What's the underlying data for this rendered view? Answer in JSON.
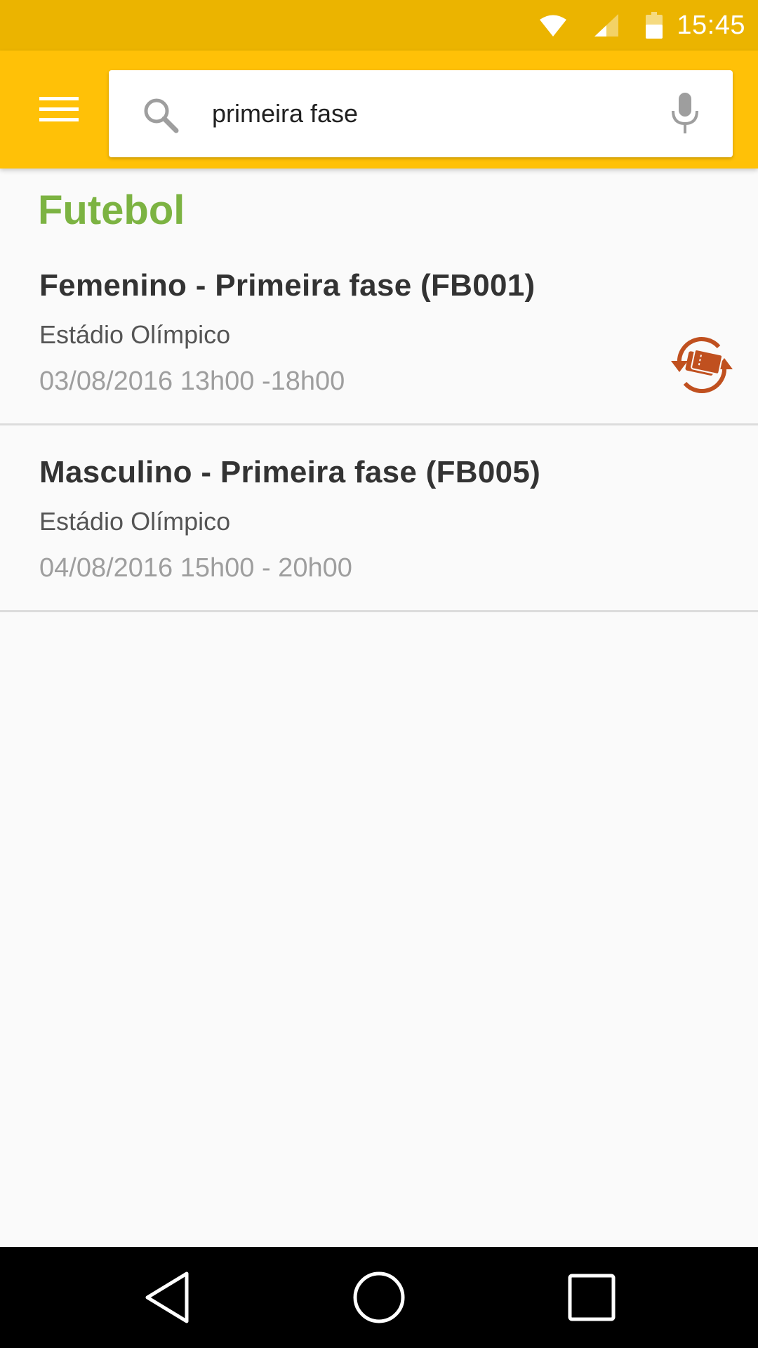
{
  "status_bar": {
    "time": "15:45",
    "icons": [
      "wifi-icon",
      "signal-icon",
      "battery-icon"
    ]
  },
  "toolbar": {
    "menu_icon": "hamburger-menu-icon",
    "search": {
      "value": "primeira fase",
      "search_icon": "search-icon",
      "voice_icon": "microphone-icon"
    }
  },
  "section": {
    "title": "Futebol",
    "color": "#7cb342"
  },
  "events": [
    {
      "title": "Femenino - Primeira fase (FB001)",
      "venue": "Estádio Olímpico",
      "datetime": "03/08/2016 13h00 -18h00",
      "icon": "ticket-exchange-icon"
    },
    {
      "title": "Masculino - Primeira fase (FB005)",
      "venue": "Estádio Olímpico",
      "datetime": "04/08/2016 15h00 - 20h00"
    }
  ],
  "nav_bar": {
    "buttons": [
      "back-icon",
      "home-icon",
      "recents-icon"
    ]
  },
  "colors": {
    "status_bar": "#ebb400",
    "toolbar": "#ffc107",
    "accent_icon": "#c0501f"
  }
}
